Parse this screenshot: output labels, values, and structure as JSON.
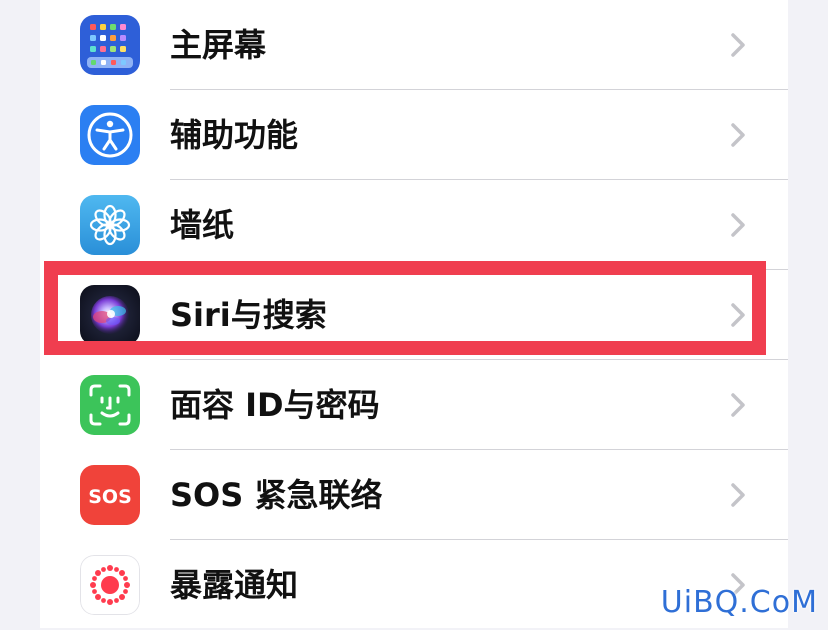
{
  "settings_list": {
    "items": [
      {
        "label": "主屏幕",
        "icon": "home-screen-icon"
      },
      {
        "label": "辅助功能",
        "icon": "accessibility-icon"
      },
      {
        "label": "墙纸",
        "icon": "wallpaper-flower-icon"
      },
      {
        "label": "Siri与搜索",
        "icon": "siri-icon"
      },
      {
        "label": "面容 ID与密码",
        "icon": "face-id-icon"
      },
      {
        "label": "SOS 紧急联络",
        "icon": "sos-icon",
        "icon_text": "SOS"
      },
      {
        "label": "暴露通知",
        "icon": "exposure-notification-icon"
      }
    ],
    "highlighted_item": "Siri与搜索"
  },
  "colors": {
    "highlight_border": "#f03e4f",
    "chevron": "#c4c4c9",
    "home_screen": "#2e5fd8",
    "accessibility": "#2b7ff2",
    "wallpaper": "#36a6e8",
    "face_id": "#3cc45a",
    "sos": "#f0433a",
    "exposure": "#ff3b4e",
    "watermark": "#2f6fd6"
  },
  "watermark": "UiBQ.CoM"
}
